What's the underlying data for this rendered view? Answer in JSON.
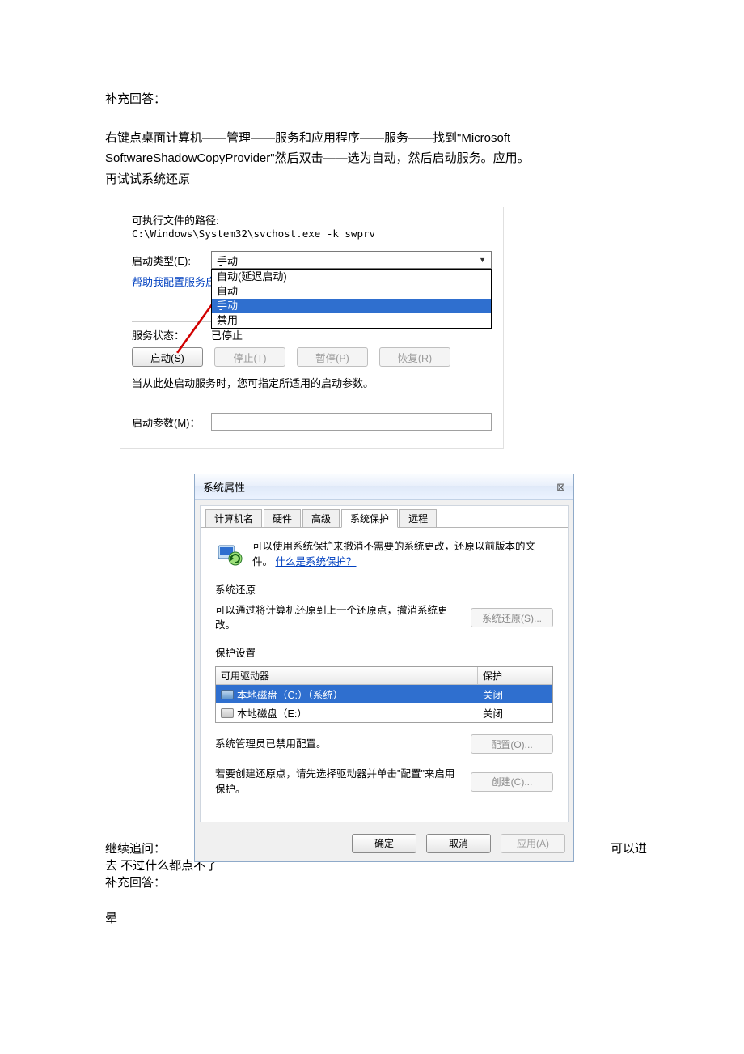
{
  "doc": {
    "reply_head": "补充回答：",
    "instructions_line1": "右键点桌面计算机——管理——服务和应用程序——服务——找到\"Microsoft",
    "instructions_line2": "SoftwareShadowCopyProvider\"然后双击——选为自动，然后启动服务。应用。",
    "instructions_line3": "再试试系统还原",
    "followup_label": "继续追问：",
    "followup_tail": "可以进",
    "followup_cont": "去 不过什么都点不了",
    "reply2": "补充回答：",
    "dizzy": "晕"
  },
  "svc": {
    "path_label": "可执行文件的路径:",
    "path_value": "C:\\Windows\\System32\\svchost.exe -k swprv",
    "startup_type_label": "启动类型(E):",
    "startup_selected": "手动",
    "options": {
      "delayed": "自动(延迟启动)",
      "auto": "自动",
      "manual": "手动",
      "disabled": "禁用"
    },
    "help_link": "帮助我配置服务启",
    "status_label": "服务状态：",
    "status_value": "已停止",
    "btn_start": "启动(S)",
    "btn_stop": "停止(T)",
    "btn_pause": "暂停(P)",
    "btn_resume": "恢复(R)",
    "hint": "当从此处启动服务时，您可指定所适用的启动参数。",
    "params_label": "启动参数(M)："
  },
  "sys": {
    "title": "系统属性",
    "close_marker": "⊠",
    "tabs": {
      "computer": "计算机名",
      "hardware": "硬件",
      "advanced": "高级",
      "protection": "系统保护",
      "remote": "远程"
    },
    "head_text_a": "可以使用系统保护来撤消不需要的系统更改，还原以前版本的文件。",
    "head_link": "什么是系统保护？",
    "group_restore": "系统还原",
    "restore_text": "可以通过将计算机还原到上一个还原点，撤消系统更改。",
    "btn_restore": "系统还原(S)...",
    "group_protect": "保护设置",
    "col_drive": "可用驱动器",
    "col_protect": "保护",
    "drive_c": "本地磁盘（C:）（系统）",
    "drive_c_state": "关闭",
    "drive_e": "本地磁盘（E:）",
    "drive_e_state": "关闭",
    "admin_disabled": "系统管理员已禁用配置。",
    "btn_config": "配置(O)...",
    "create_text": "若要创建还原点，请先选择驱动器并单击\"配置\"来启用保护。",
    "btn_create": "创建(C)...",
    "btn_ok": "确定",
    "btn_cancel": "取消",
    "btn_apply": "应用(A)"
  }
}
